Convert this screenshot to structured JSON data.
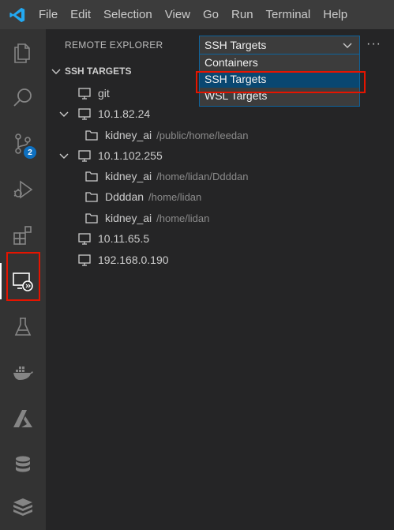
{
  "menubar": {
    "items": [
      "File",
      "Edit",
      "Selection",
      "View",
      "Go",
      "Run",
      "Terminal",
      "Help"
    ]
  },
  "activity": {
    "scm_badge": "2"
  },
  "sidebar": {
    "header": "REMOTE EXPLORER",
    "select_value": "SSH Targets",
    "options": [
      "Containers",
      "SSH Targets",
      "WSL Targets"
    ],
    "more": "···",
    "section": "SSH TARGETS",
    "tree": {
      "git": "git",
      "host1": "10.1.82.24",
      "host1_child": {
        "name": "kidney_ai",
        "path": "/public/home/leedan"
      },
      "host2": "10.1.102.255",
      "host2_children": [
        {
          "name": "kidney_ai",
          "path": "/home/lidan/Ddddan"
        },
        {
          "name": "Ddddan",
          "path": "/home/lidan"
        },
        {
          "name": "kidney_ai",
          "path": "/home/lidan"
        }
      ],
      "host3": "10.11.65.5",
      "host4": "192.168.0.190"
    }
  },
  "colors": {
    "accent": "#0e639c",
    "selection": "#094771",
    "highlight_border": "#e51400"
  }
}
